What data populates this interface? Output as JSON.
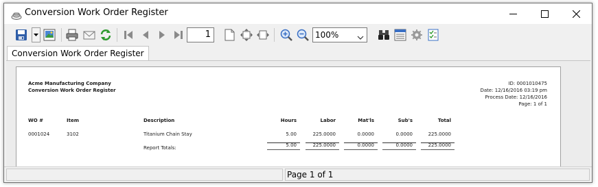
{
  "window": {
    "title": "Conversion Work Order Register"
  },
  "toolbar": {
    "page_number": "1",
    "zoom": "100%",
    "icons": [
      "save-icon",
      "export-icon",
      "print-icon",
      "email-icon",
      "refresh-icon",
      "first-page-icon",
      "previous-page-icon",
      "next-page-icon",
      "last-page-icon",
      "single-page-icon",
      "fit-page-icon",
      "fit-width-icon",
      "zoom-in-icon",
      "zoom-out-icon",
      "find-icon",
      "page-setup-icon",
      "settings-icon",
      "options-icon"
    ]
  },
  "tabs": [
    {
      "label": "Conversion Work Order Register"
    }
  ],
  "report": {
    "company": "Acme Manufacturing Company",
    "title": "Conversion Work Order Register",
    "id_line": "ID: 0001010475",
    "date_line": "Date: 12/16/2016 03:19 pm",
    "process_date_line": "Process Date: 12/16/2016",
    "page_line": "Page: 1 of 1",
    "columns": {
      "wo": "WO #",
      "item": "Item",
      "description": "Description",
      "hours": "Hours",
      "labor": "Labor",
      "matls": "Mat'ls",
      "subs": "Sub's",
      "total": "Total"
    },
    "rows": [
      {
        "wo": "0001024",
        "item": "3102",
        "description": "Titanium Chain Stay",
        "hours": "5.00",
        "labor": "225.0000",
        "matls": "0.0000",
        "subs": "0.0000",
        "total": "225.0000"
      }
    ],
    "totals": {
      "label": "Report Totals:",
      "hours": "5.00",
      "labor": "225.0000",
      "matls": "0.0000",
      "subs": "0.0000",
      "total": "225.0000"
    }
  },
  "status": {
    "page_text": "Page 1 of 1"
  },
  "colors": {
    "save_blue": "#2f5ea8",
    "refresh_green": "#2e9a2e",
    "nav_grey": "#8a8a8a",
    "zoom_blue": "#3a6fc4"
  }
}
